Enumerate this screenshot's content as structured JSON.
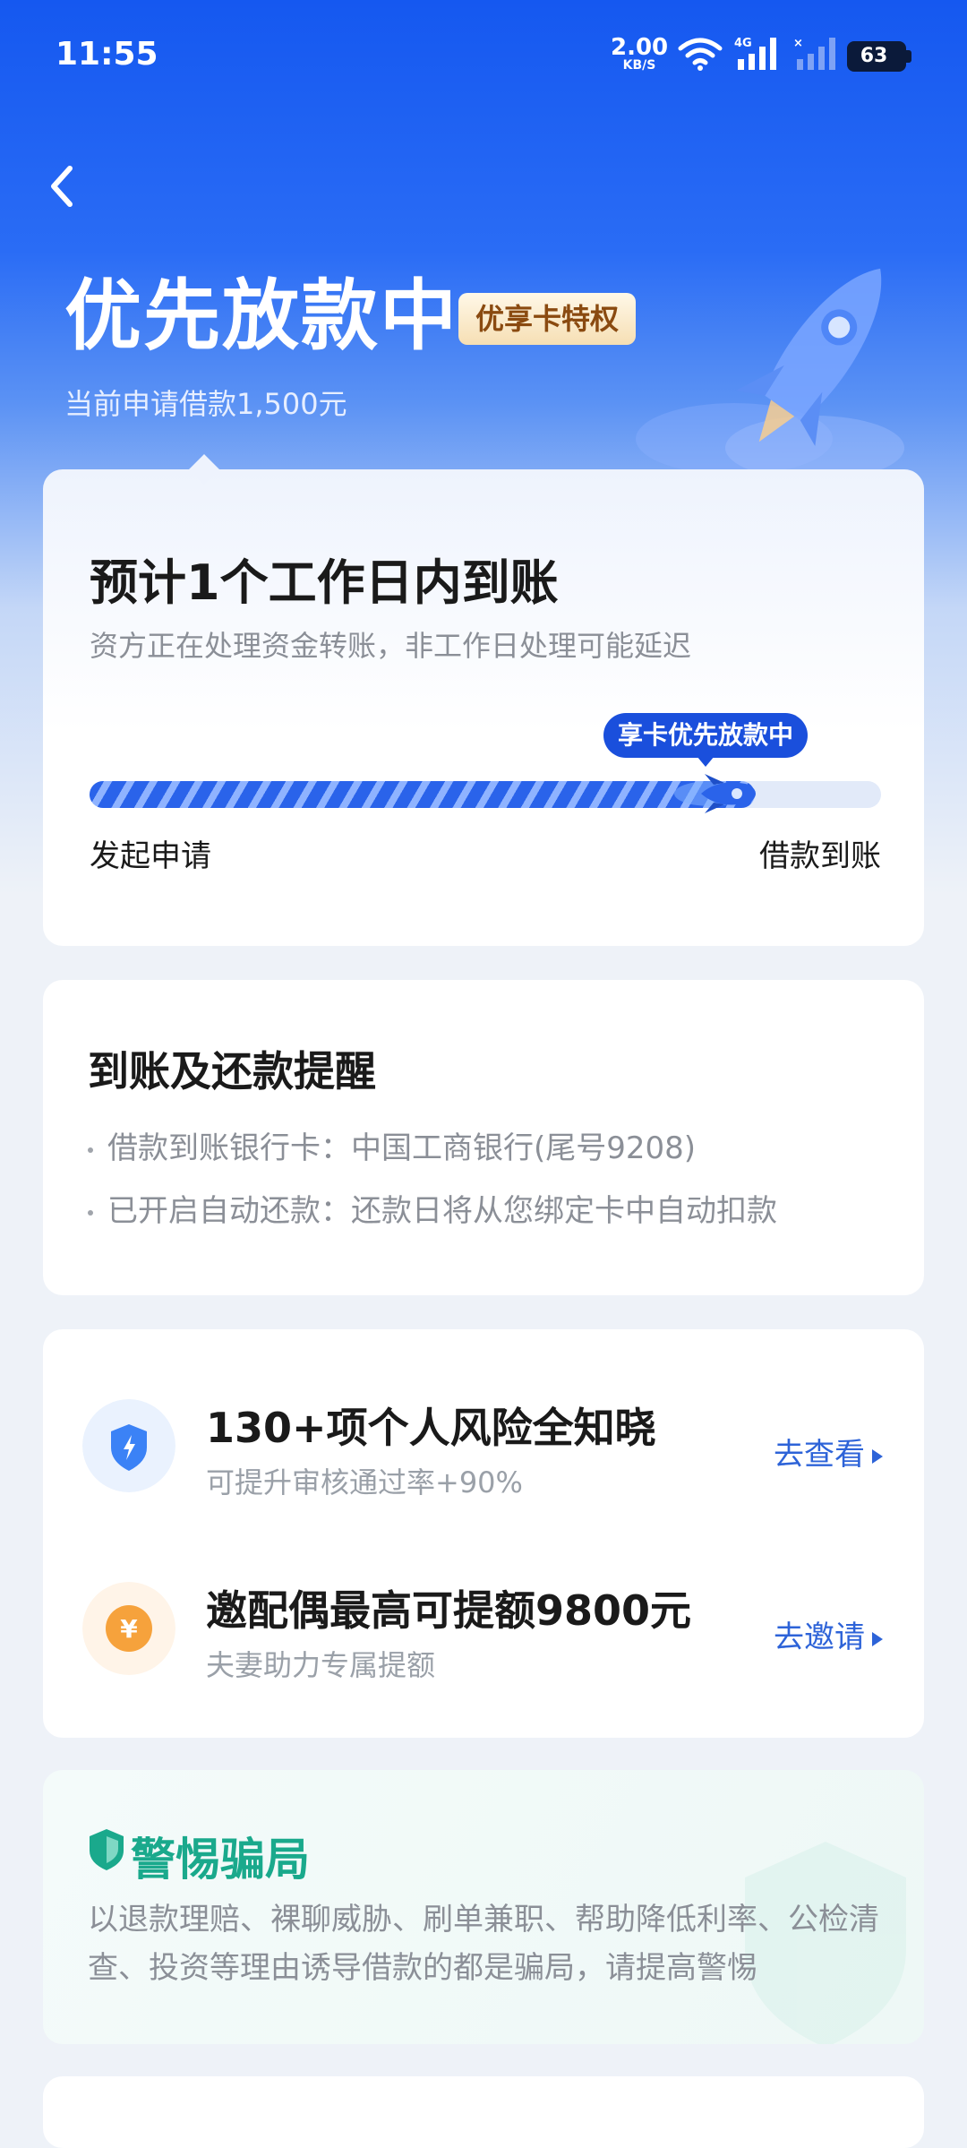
{
  "status_bar": {
    "time": "11:55",
    "net_speed_value": "2.00",
    "net_speed_unit": "KB/S",
    "network_type": "4G",
    "battery": "63"
  },
  "header": {
    "title": "优先放款中",
    "badge": "优享卡特权",
    "subtitle": "当前申请借款1,500元"
  },
  "progress_card": {
    "title": "预计1个工作日内到账",
    "description": "资方正在处理资金转账，非工作日处理可能延迟",
    "tag": "享卡优先放款中",
    "progress": 0.84,
    "start_label": "发起申请",
    "end_label": "借款到账"
  },
  "reminder_card": {
    "title": "到账及还款提醒",
    "items": [
      "借款到账银行卡：中国工商银行(尾号9208)",
      "已开启自动还款：还款日将从您绑定卡中自动扣款"
    ]
  },
  "promo_card": {
    "rows": [
      {
        "title": "130+项个人风险全知晓",
        "subtitle": "可提升审核通过率+90%",
        "action": "去查看",
        "icon": "lightning-shield-icon"
      },
      {
        "title": "邀配偶最高可提额9800元",
        "subtitle": "夫妻助力专属提额",
        "action": "去邀请",
        "icon": "yuan-coin-icon"
      }
    ]
  },
  "warning_card": {
    "title": "警惕骗局",
    "body": "以退款理赔、裸聊威胁、刷单兼职、帮助降低利率、公检清查、投资等理由诱导借款的都是骗局，请提高警惕"
  },
  "colors": {
    "brand_blue": "#1558f0",
    "progress_blue": "#2a63ea",
    "badge_gold": "#f6dfb4",
    "warning_green": "#1aa98c"
  }
}
